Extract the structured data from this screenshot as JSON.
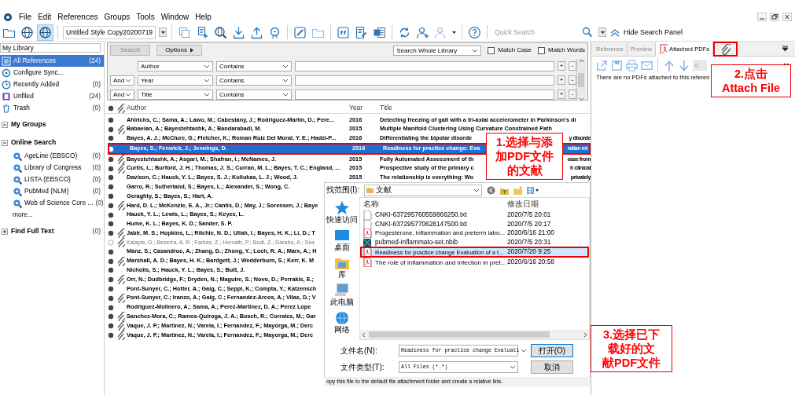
{
  "menu": [
    "File",
    "Edit",
    "References",
    "Groups",
    "Tools",
    "Window",
    "Help"
  ],
  "toolbar": {
    "style": "Untitled Style Copy20200719",
    "quick_search": {
      "placeholder": "Quick Search"
    },
    "hide_search_panel": "Hide Search Panel"
  },
  "sidebar": {
    "library_field": {
      "value": "My Library"
    },
    "items": [
      {
        "label": "All References",
        "count": "(24)",
        "selected": true
      },
      {
        "label": "Configure Sync...",
        "selected": false
      },
      {
        "label": "Recently Added",
        "count": "(0)",
        "selected": false
      },
      {
        "label": "Unfiled",
        "count": "(24)",
        "selected": false
      },
      {
        "label": "Trash",
        "count": "(0)",
        "selected": false
      }
    ],
    "sections": [
      {
        "title": "My Groups",
        "expanded": true
      },
      {
        "title": "Online Search",
        "expanded": true,
        "items": [
          {
            "label": "AgeLine (EBSCO)",
            "count": "(0)"
          },
          {
            "label": "Library of Congress",
            "count": "(0)"
          },
          {
            "label": "LISTA (EBSCO)",
            "count": "(0)"
          },
          {
            "label": "PubMed (NLM)",
            "count": "(0)"
          },
          {
            "label": "Web of Science Core ...",
            "count": "(0)"
          }
        ],
        "more": "more..."
      },
      {
        "title": "Find Full Text",
        "count": "(0)",
        "expanded": false
      }
    ]
  },
  "search_panel": {
    "search_button": {
      "label": "Search",
      "disabled": true
    },
    "options_button": "Options",
    "scope": "Search Whole Library",
    "match_case": {
      "label": "Match Case",
      "checked": false
    },
    "match_words": {
      "label": "Match Words",
      "checked": false
    },
    "rows": [
      {
        "field": "Author",
        "condition": "Contains",
        "add": "+",
        "remove": "-"
      },
      {
        "operator": "And",
        "field": "Year",
        "condition": "Contains",
        "add": "+",
        "remove": "-"
      },
      {
        "operator": "And",
        "field": "Title",
        "condition": "Contains",
        "add": "+",
        "remove": "-"
      }
    ]
  },
  "table": {
    "columns": [
      "Author",
      "Year",
      "Title"
    ],
    "rows": [
      {
        "author": "Ahlrichs, C.; Sama, A.; Lawo, M.; Cabestany, J.; Rodriguez-Martin, D.; Pere...",
        "year": "2016",
        "title": "Detecting freezing of gait with a tri-axial accelerometer in Parkinson's di",
        "read": false,
        "attachment": false,
        "selected": false,
        "highlighted": false
      },
      {
        "author": "Babaeian, A.; Bayestehtashk, A.; Bandarabadi, M.",
        "year": "2015",
        "title": "Multiple Manifold Clustering Using Curvature Constrained Path",
        "read": false,
        "attachment": true,
        "selected": false,
        "highlighted": false
      },
      {
        "author": "Bayes, A. J.; McClure, G.; Fletcher, K.; Roman Ruiz Del Moral, Y. E.; Hadzi-P...",
        "year": "2016",
        "title": "Differentiating the bipolar disorde",
        "title_end": "y disorde",
        "read": false,
        "attachment": false,
        "selected": false,
        "highlighted": false
      },
      {
        "author": "Bayes, S.; Fenwick, J.; Jennings, D.",
        "year": "2016",
        "title": "Readiness for practice change: Eva",
        "title_end": "ralian mi",
        "read": false,
        "attachment": false,
        "selected": true,
        "highlighted": true
      },
      {
        "author": "Bayestehtashk, A.; Asgari, M.; Shafran, I.; McNames, J.",
        "year": "2015",
        "title": "Fully Automated Assessment of th",
        "title_end": "ease from",
        "read": false,
        "attachment": true,
        "selected": false,
        "highlighted": false
      },
      {
        "author": "Curtis, L.; Burford, J. H.; Thomas, J. S.; Curran, M. L.; Bayes, T. C.; England, ...",
        "year": "2015",
        "title": "Prospective study of the primary c",
        "title_end": "h clinical",
        "read": false,
        "attachment": true,
        "selected": false,
        "highlighted": false
      },
      {
        "author": "Davison, C.; Hauck, Y. L.; Bayes, S. J.; Kuliukas, L. J.; Wood, J.",
        "year": "2015",
        "title": "The relationship is everything: Wo",
        "title_end": "privately",
        "read": false,
        "attachment": false,
        "selected": false,
        "highlighted": false
      },
      {
        "author": "Garro, R.; Sutherland, S.; Bayes, L.; Alexander, S.; Wong, C.",
        "read": false,
        "attachment": false,
        "selected": false,
        "highlighted": false
      },
      {
        "author": "Geraghty, S.; Bayes, S.; Hart, A.",
        "read": false,
        "attachment": false,
        "selected": false,
        "highlighted": false
      },
      {
        "author": "Hard, D. L.; McKenzie, E. A., Jr.; Cantis, D.; May, J.; Sorensen, J.; Baye",
        "read": false,
        "attachment": true,
        "selected": false,
        "highlighted": false
      },
      {
        "author": "Hauck, Y. L.; Lewis, L.; Bayes, S.; Keyes, L.",
        "read": false,
        "attachment": false,
        "selected": false,
        "highlighted": false
      },
      {
        "author": "Hume, K. L.; Bayes, K. D.; Sander, S. P.",
        "read": false,
        "attachment": false,
        "selected": false,
        "highlighted": false
      },
      {
        "author": "Jabir, M. S.; Hopkins, L.; Ritchie, N. D.; Ullah, I.; Bayes, H. K.; Li, D.; T",
        "read": false,
        "attachment": true,
        "selected": false,
        "highlighted": false
      },
      {
        "author": "Kalapis, D.; Bezerra, A. R.; Farkas, Z.; Horvath, P.; Bodi, Z.; Daraba, A.; Sza",
        "read": true,
        "attachment": true,
        "selected": false,
        "highlighted": false
      },
      {
        "author": "Manz, S.; Casandruc, A.; Zhang, D.; Zhong, Y.; Loch, R. A.; Marx, A.; H",
        "read": false,
        "attachment": false,
        "selected": false,
        "highlighted": false
      },
      {
        "author": "Marshall, A. D.; Bayes, H. K.; Bardgett, J.; Wedderburn, S.; Kerr, K. M",
        "read": false,
        "attachment": true,
        "selected": false,
        "highlighted": false
      },
      {
        "author": "Nicholls, S.; Hauck, Y. L.; Bayes, S.; Butt, J.",
        "read": false,
        "attachment": false,
        "selected": false,
        "highlighted": false
      },
      {
        "author": "Orr, N.; Dudbridge, F.; Dryden, N.; Maguire, S.; Novo, D.; Perrakis, E.;",
        "read": false,
        "attachment": true,
        "selected": false,
        "highlighted": false
      },
      {
        "author": "Pont-Sunyer, C.; Hotter, A.; Gaig, C.; Seppi, K.; Compta, Y.; Katzensch",
        "read": false,
        "attachment": false,
        "selected": false,
        "highlighted": false
      },
      {
        "author": "Pont-Sunyer, C.; Iranzo, A.; Gaig, C.; Fernandez-Arcos, A.; Vilas, D.; V",
        "read": false,
        "attachment": true,
        "selected": false,
        "highlighted": false
      },
      {
        "author": "Rodriguez-Molinero, A.; Sama, A.; Perez-Martinez, D. A.; Perez Lope",
        "read": false,
        "attachment": false,
        "selected": false,
        "highlighted": false
      },
      {
        "author": "Sanchez-Mora, C.; Ramos-Quiroga, J. A.; Bosch, R.; Corrales, M.; Gar",
        "read": false,
        "attachment": true,
        "selected": false,
        "highlighted": false
      },
      {
        "author": "Vaque, J. P.; Martinez, N.; Varela, I.; Fernandez, F.; Mayorga, M.; Derc",
        "read": false,
        "attachment": true,
        "selected": false,
        "highlighted": false
      },
      {
        "author": "Vaque, J. P.; Martinez, N.; Varela, I.; Fernandez, F.; Mayorga, M.; Derc",
        "read": false,
        "attachment": true,
        "selected": false,
        "highlighted": false
      }
    ]
  },
  "right_panel": {
    "tabs": [
      {
        "kind": "text",
        "label": "Reference",
        "selected": false,
        "highlighted": false
      },
      {
        "kind": "text",
        "label": "Preview",
        "selected": false,
        "highlighted": false
      },
      {
        "kind": "pdf",
        "label": "Attached PDFs",
        "selected": true,
        "highlighted": false
      },
      {
        "kind": "attach",
        "selected": false,
        "highlighted": true
      }
    ],
    "page_field": "0",
    "message": "There are no PDFs attached to this referen"
  },
  "file_dialog": {
    "look_in_label": "找范围(I):",
    "folder": "文献",
    "places": [
      "快速访问",
      "桌面",
      "库",
      "此电脑",
      "网络"
    ],
    "columns": [
      "名称",
      "修改日期"
    ],
    "files": [
      {
        "kind": "text",
        "name": "CNKI-637295760559866250.txt",
        "modified": "2020/7/5 20:01",
        "selected": false,
        "highlighted": false
      },
      {
        "kind": "text",
        "name": "CNKI-637295770628147500.txt",
        "modified": "2020/7/5 20:17",
        "selected": false,
        "highlighted": false
      },
      {
        "kind": "pdf",
        "name": "Progesterone, inflammation and preterm labo...",
        "modified": "2020/6/16 21:00",
        "selected": false,
        "highlighted": false
      },
      {
        "kind": "nbib",
        "name": "pubmed-inflammato-set.nbib",
        "modified": "2020/7/5 20:31",
        "selected": false,
        "highlighted": false
      },
      {
        "kind": "pdf",
        "name": "Readiness for practice change Evaluation of a t...",
        "modified": "2020/7/20 9:25",
        "selected": true,
        "highlighted": true
      },
      {
        "kind": "pdf",
        "name": "The role of inflammation and infection in pret...",
        "modified": "2020/6/16 20:58",
        "selected": false,
        "highlighted": false
      }
    ],
    "filename_label": "文件名(N):",
    "filename": "Readiness for practice change Evaluati",
    "filetype_label": "文件类型(T):",
    "filetype": "All Files (*.*)",
    "open_button": "打开(O)",
    "cancel_button": "取消"
  },
  "footer_note": "opy this file to the default file attachment folder and create a relative link.",
  "callouts": [
    {
      "lines": [
        "1.选择与添",
        "加PDF文件",
        "的文献"
      ]
    },
    {
      "lines": [
        "2.点击",
        "Attach File"
      ]
    },
    {
      "lines": [
        "3.选择已下",
        "载好的文",
        "献PDF文件"
      ]
    }
  ]
}
